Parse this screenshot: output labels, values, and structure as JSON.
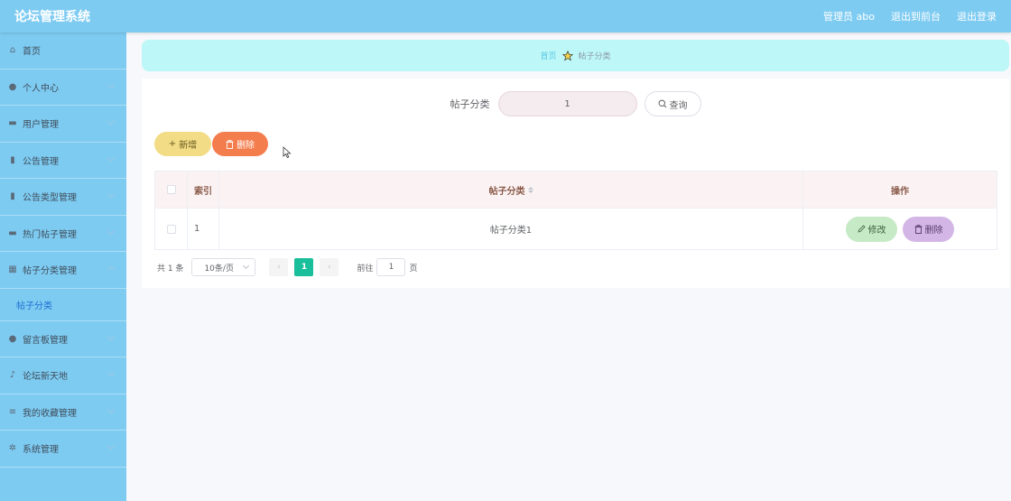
{
  "header": {
    "brand": "论坛管理系统",
    "admin_label": "管理员 abo",
    "back_label": "退出到前台",
    "logout_label": "退出登录"
  },
  "sidebar": {
    "items": [
      {
        "label": "首页",
        "icon": "home-icon",
        "glyph": "⌂"
      },
      {
        "label": "个人中心",
        "icon": "user-icon",
        "glyph": "●"
      },
      {
        "label": "用户管理",
        "icon": "users-icon",
        "glyph": "▬"
      },
      {
        "label": "公告管理",
        "icon": "notice-icon",
        "glyph": "▮"
      },
      {
        "label": "公告类型管理",
        "icon": "bar-chart-icon",
        "glyph": "▮"
      },
      {
        "label": "热门帖子管理",
        "icon": "print-icon",
        "glyph": "▬"
      },
      {
        "label": "帖子分类管理",
        "icon": "grid-icon",
        "glyph": "▦"
      },
      {
        "label": "留言板管理",
        "icon": "user-icon",
        "glyph": "●"
      },
      {
        "label": "论坛新天地",
        "icon": "mic-icon",
        "glyph": "♪"
      },
      {
        "label": "我的收藏管理",
        "icon": "list-icon",
        "glyph": "≡"
      },
      {
        "label": "系统管理",
        "icon": "settings-icon",
        "glyph": "✲"
      }
    ],
    "submenu": {
      "label": "帖子分类"
    }
  },
  "breadcrumb": {
    "home": "首页",
    "current": "帖子分类"
  },
  "search": {
    "label": "帖子分类",
    "value": "1",
    "button": "查询"
  },
  "actions": {
    "add": "新增",
    "delete": "删除"
  },
  "table": {
    "headers": {
      "index": "索引",
      "category": "帖子分类",
      "ops": "操作"
    },
    "rows": [
      {
        "index": "1",
        "category": "帖子分类1",
        "edit": "修改",
        "delete": "删除"
      }
    ]
  },
  "pagination": {
    "total": "共 1 条",
    "page_size": "10条/页",
    "prev": "‹",
    "current_page": "1",
    "next": "›",
    "goto_label": "前往",
    "goto_value": "1",
    "page_unit": "页"
  },
  "colors": {
    "topbar": "#7ecbf2",
    "breadcrumb_bg": "#bdf7f7",
    "add_button": "#f2dc86",
    "delete_button": "#f47d4e",
    "active_page": "#19be9b",
    "edit_button": "#c6eac6",
    "row_delete_button": "#d4b6e6"
  }
}
